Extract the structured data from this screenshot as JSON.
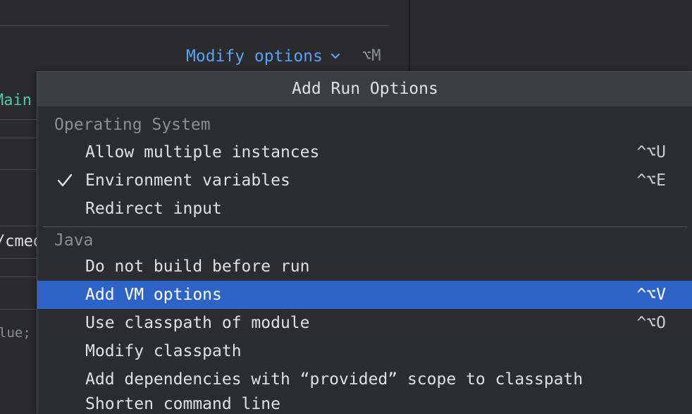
{
  "editor": {
    "modify_label": "Modify options",
    "modify_shortcut": "⌥M",
    "main_class_fragment": "Main",
    "path_fragment": "/cmed",
    "code_fragment": "lue;"
  },
  "colors": {
    "accent_link": "#5aa2f5",
    "selection": "#2e64c7",
    "code_green": "#4ec9a8"
  },
  "popup": {
    "title": "Add Run Options",
    "sections": [
      {
        "title": "Operating System",
        "items": [
          {
            "label": "Allow multiple instances",
            "shortcut": "^⌥U",
            "checked": false
          },
          {
            "label": "Environment variables",
            "shortcut": "^⌥E",
            "checked": true
          },
          {
            "label": "Redirect input",
            "shortcut": "",
            "checked": false
          }
        ]
      },
      {
        "title": "Java",
        "items": [
          {
            "label": "Do not build before run",
            "shortcut": "",
            "checked": false
          },
          {
            "label": "Add VM options",
            "shortcut": "^⌥V",
            "checked": false,
            "selected": true
          },
          {
            "label": "Use classpath of module",
            "shortcut": "^⌥O",
            "checked": false
          },
          {
            "label": "Modify classpath",
            "shortcut": "",
            "checked": false
          },
          {
            "label": "Add dependencies with “provided” scope to classpath",
            "shortcut": "",
            "checked": false
          },
          {
            "label": "Shorten command line",
            "shortcut": "",
            "checked": false
          }
        ]
      }
    ]
  }
}
